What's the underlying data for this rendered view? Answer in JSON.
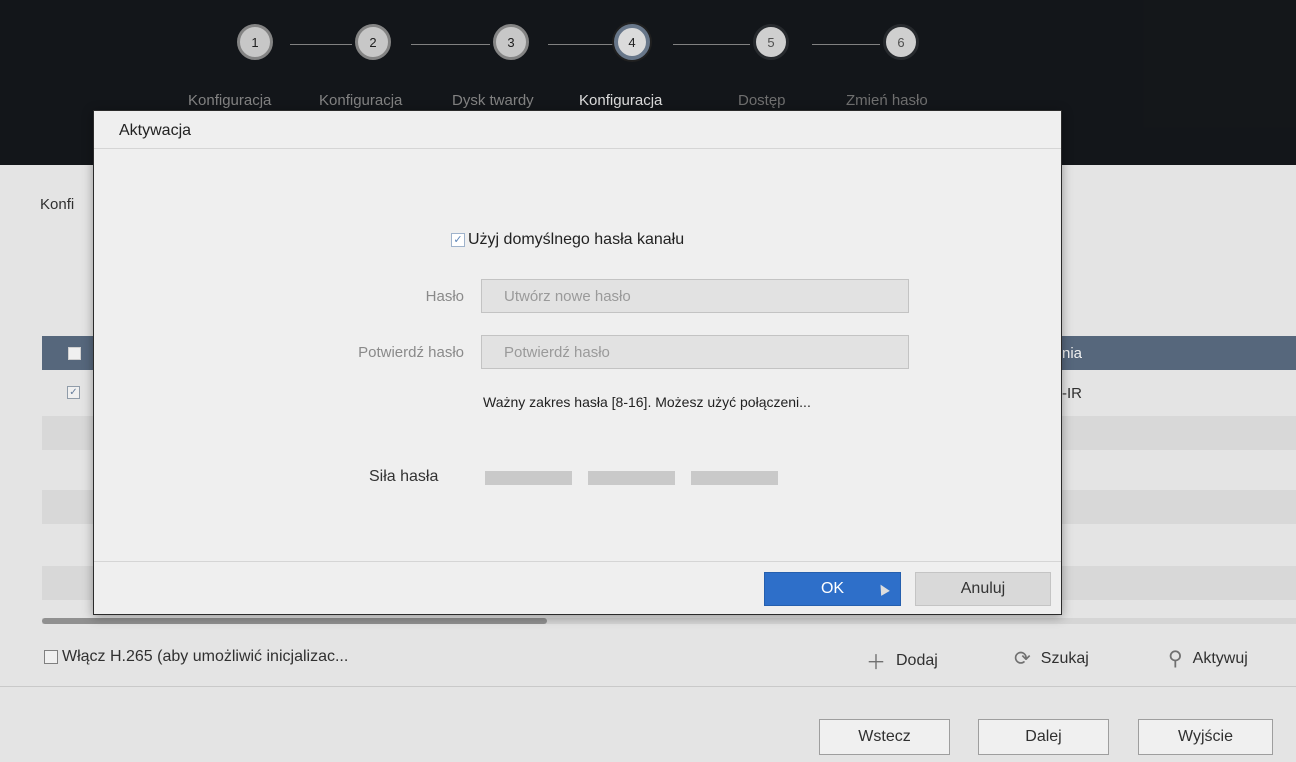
{
  "wizard": {
    "steps": [
      {
        "number": "1",
        "label": "Konfiguracja",
        "state": "done"
      },
      {
        "number": "2",
        "label": "Konfiguracja",
        "state": "done"
      },
      {
        "number": "3",
        "label": "Dysk twardy",
        "state": "done"
      },
      {
        "number": "4",
        "label": "Konfiguracja",
        "state": "current"
      },
      {
        "number": "5",
        "label": "Dostęp",
        "state": "future"
      },
      {
        "number": "6",
        "label": "Zmień hasło",
        "state": "future"
      }
    ]
  },
  "main": {
    "section_title": "Konfi",
    "table": {
      "header_text": "nia",
      "rows": [
        {
          "checked": true,
          "text": "-IR"
        }
      ]
    },
    "h265_label": "Włącz H.265 (aby umożliwić inicjalizac...",
    "actions": {
      "add": "Dodaj",
      "search": "Szukaj",
      "activate": "Aktywuj"
    }
  },
  "footer": {
    "back": "Wstecz",
    "next": "Dalej",
    "exit": "Wyjście"
  },
  "dialog": {
    "title": "Aktywacja",
    "use_default_label": "Użyj domyślnego hasła kanału",
    "use_default_checked": true,
    "password_label": "Hasło",
    "password_placeholder": "Utwórz nowe hasło",
    "confirm_label": "Potwierdź hasło",
    "confirm_placeholder": "Potwierdź hasło",
    "hint": "Ważny zakres hasła [8-16]. Możesz użyć połączeni...",
    "strength_label": "Siła hasła",
    "ok": "OK",
    "cancel": "Anuluj"
  },
  "colors": {
    "primary_button": "#2e6fc9",
    "table_header": "#5c6e84",
    "header_background": "#15181c"
  },
  "icons": {
    "add": "plus-icon",
    "search": "refresh-icon",
    "activate": "magnifier-icon"
  }
}
